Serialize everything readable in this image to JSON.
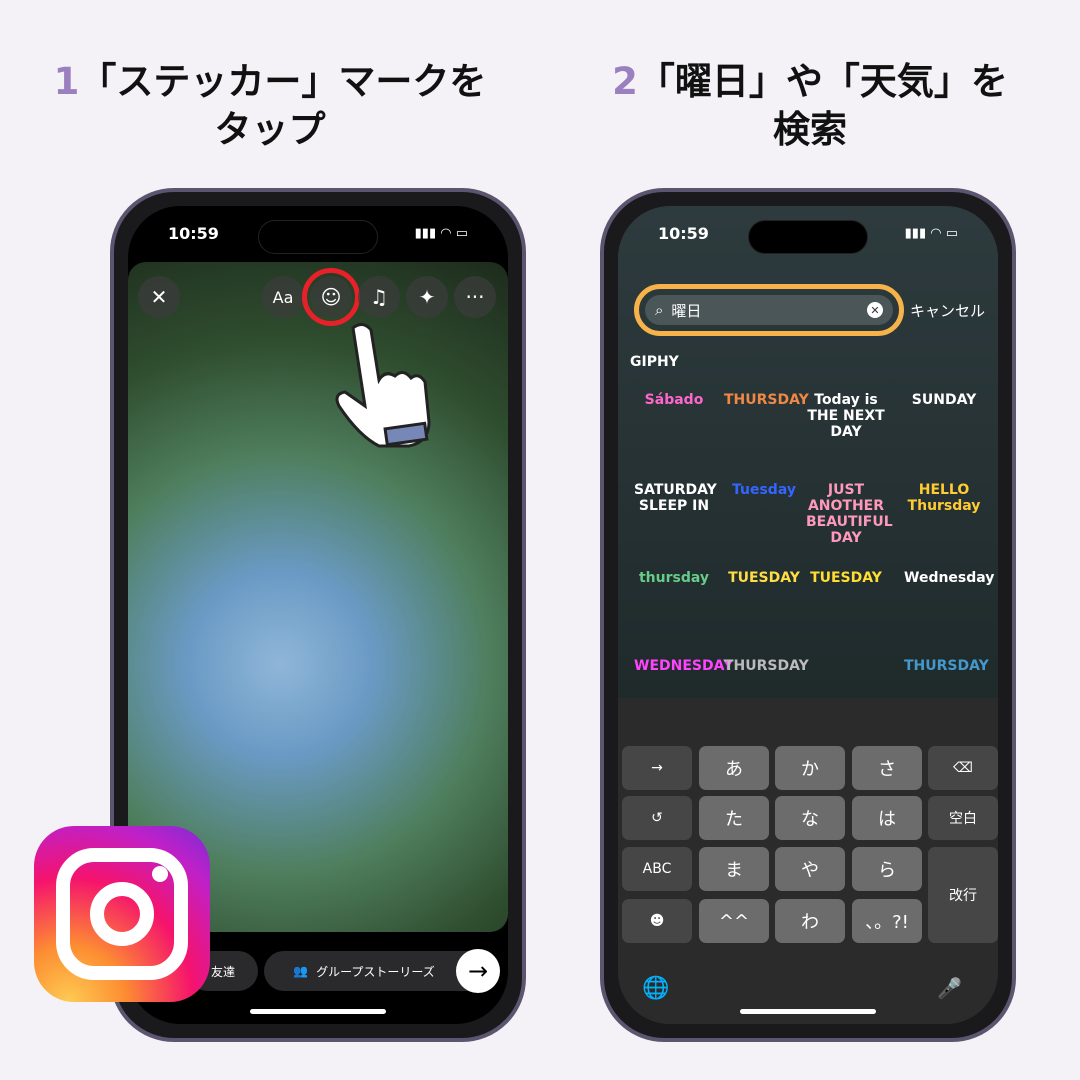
{
  "steps": [
    {
      "num": "1",
      "line1": "「ステッカー」マークを",
      "line2": "タップ"
    },
    {
      "num": "2",
      "line1": "「曜日」や「天気」を",
      "line2": "検索"
    }
  ],
  "status": {
    "time": "10:59"
  },
  "phone1": {
    "toolbar": {
      "close": "✕",
      "text": "Aa",
      "sticker": "☺",
      "music": "♫",
      "effects": "✦",
      "more": "···"
    },
    "bottom": {
      "friends": "友達",
      "group": "グループストーリーズ",
      "chevron": "⌄",
      "next": "→"
    }
  },
  "phone2": {
    "search": {
      "value": "曜日",
      "cancel": "キャンセル"
    },
    "section": "GIPHY",
    "stickers": [
      {
        "text": "Sábado",
        "color": "#f6c"
      },
      {
        "text": "THURSDAY",
        "color": "#e84"
      },
      {
        "text": "Today is THE NEXT DAY",
        "color": "#fff"
      },
      {
        "text": "SUNDAY",
        "color": "#fff"
      },
      {
        "text": "SATURDAY SLEEP IN",
        "color": "#fff"
      },
      {
        "text": "Tuesday",
        "color": "#36f"
      },
      {
        "text": "JUST ANOTHER BEAUTIFUL DAY",
        "color": "#f9b"
      },
      {
        "text": "HELLO Thursday",
        "color": "#fc3"
      },
      {
        "text": "thursday",
        "color": "#6c8"
      },
      {
        "text": "TUESDAY",
        "color": "#fd4"
      },
      {
        "text": "TUESDAY",
        "color": "#fd3"
      },
      {
        "text": "Wednesday",
        "color": "#fff"
      },
      {
        "text": "WEDNESDAY",
        "color": "#f4f"
      },
      {
        "text": "THURSDAY",
        "color": "#bbb"
      },
      {
        "text": "",
        "color": "#f3c"
      },
      {
        "text": "THURSDAY",
        "color": "#49c"
      }
    ],
    "keyboard": [
      [
        "→",
        "あ",
        "か",
        "さ",
        "⌫"
      ],
      [
        "↺",
        "た",
        "な",
        "は",
        "空白"
      ],
      [
        "ABC",
        "ま",
        "や",
        "ら",
        "改行"
      ],
      [
        "☻",
        "^^",
        "わ",
        "、。?!"
      ]
    ],
    "globe": "🌐",
    "mic": "🎤"
  },
  "colors": {
    "step": "#9a80bf",
    "highlight_red": "#e8202a",
    "highlight_orange": "#f6b34a"
  }
}
